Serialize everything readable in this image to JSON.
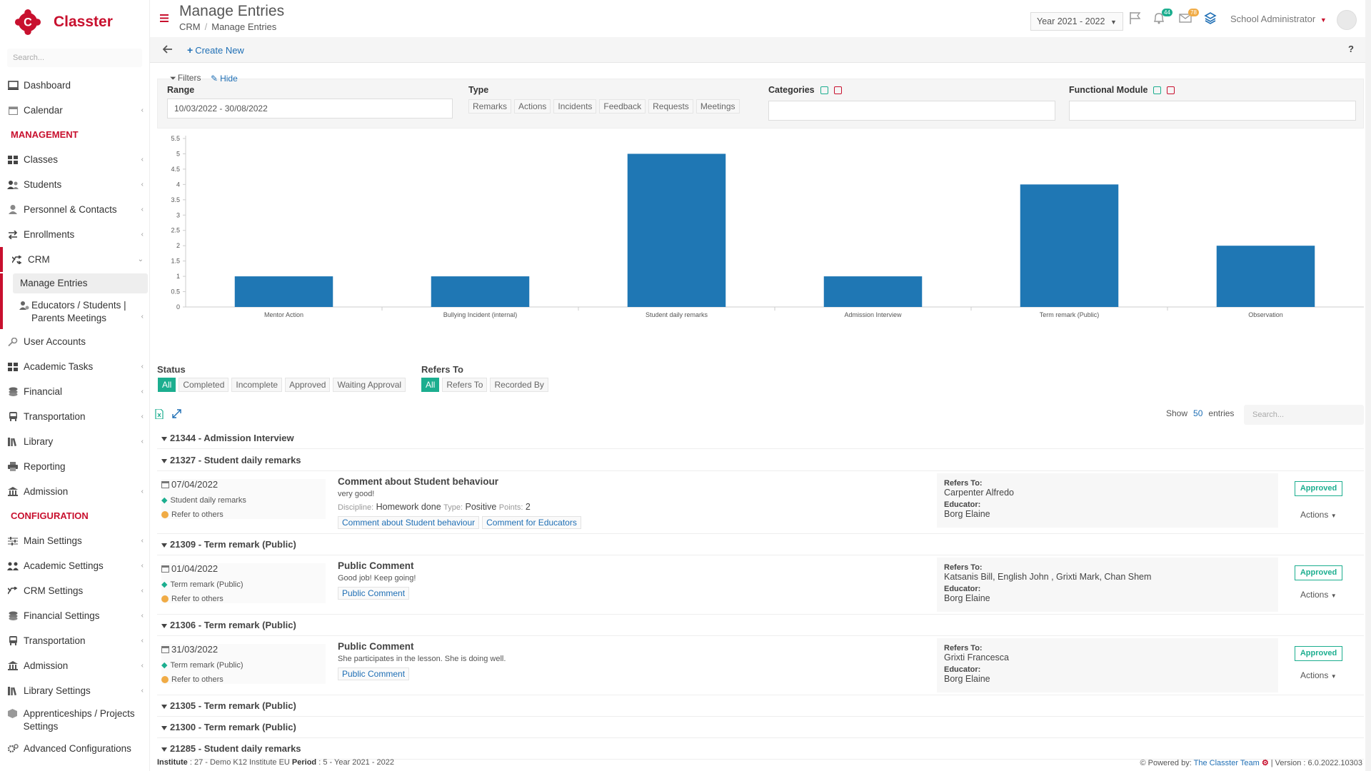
{
  "app": {
    "name": "Classter"
  },
  "sidebar": {
    "search_placeholder": "Search...",
    "items": [
      {
        "label": "Dashboard"
      },
      {
        "label": "Calendar"
      },
      {
        "section": "MANAGEMENT"
      },
      {
        "label": "Classes"
      },
      {
        "label": "Students"
      },
      {
        "label": "Personnel & Contacts"
      },
      {
        "label": "Enrollments"
      },
      {
        "label": "CRM"
      },
      {
        "label": "Manage Entries"
      },
      {
        "label": "Educators / Students | Parents Meetings"
      },
      {
        "label": "User Accounts"
      },
      {
        "label": "Academic Tasks"
      },
      {
        "label": "Financial"
      },
      {
        "label": "Transportation"
      },
      {
        "label": "Library"
      },
      {
        "label": "Reporting"
      },
      {
        "label": "Admission"
      },
      {
        "section": "CONFIGURATION"
      },
      {
        "label": "Main Settings"
      },
      {
        "label": "Academic Settings"
      },
      {
        "label": "CRM Settings"
      },
      {
        "label": "Financial Settings"
      },
      {
        "label": "Transportation"
      },
      {
        "label": "Admission"
      },
      {
        "label": "Library Settings"
      },
      {
        "label": "Apprenticeships / Projects Settings"
      },
      {
        "label": "Advanced Configurations"
      }
    ]
  },
  "header": {
    "title": "Manage Entries",
    "breadcrumb": [
      "CRM",
      "Manage Entries"
    ],
    "year": "Year 2021 - 2022",
    "notifications_count": "44",
    "messages_count": "78",
    "user": "School Administrator"
  },
  "toolbar": {
    "create_label": "Create New",
    "help": "?"
  },
  "filters": {
    "label": "Filters",
    "hide": "Hide",
    "range_label": "Range",
    "range_value": "10/03/2022 - 30/08/2022",
    "type_label": "Type",
    "types": [
      "Remarks",
      "Actions",
      "Incidents",
      "Feedback",
      "Requests",
      "Meetings"
    ],
    "categories_label": "Categories",
    "functional_label": "Functional Module"
  },
  "chart_data": {
    "type": "bar",
    "categories": [
      "Mentor Action",
      "Bullying Incident (internal)",
      "Student daily remarks",
      "Admission Interview",
      "Term remark (Public)",
      "Observation"
    ],
    "values": [
      1,
      1,
      5,
      1,
      4,
      2
    ],
    "ylim": [
      0,
      5.5
    ],
    "yticks": [
      "0",
      "0.5",
      "1",
      "1.5",
      "2",
      "2.5",
      "3",
      "3.5",
      "4",
      "4.5",
      "5",
      "5.5"
    ],
    "color": "#1f77b4"
  },
  "status": {
    "label": "Status",
    "options": [
      "All",
      "Completed",
      "Incomplete",
      "Approved",
      "Waiting Approval"
    ],
    "refers_label": "Refers To",
    "refers_options": [
      "All",
      "Refers To",
      "Recorded By"
    ]
  },
  "list": {
    "show": "Show",
    "count": "50",
    "entries": "entries",
    "search_placeholder": "Search..."
  },
  "groups": [
    {
      "head": "21344 - Admission Interview"
    },
    {
      "head": "21327 - Student daily remarks"
    },
    {
      "head": "21309 - Term remark (Public)"
    },
    {
      "head": "21306 - Term remark (Public)"
    },
    {
      "head": "21305 - Term remark (Public)"
    },
    {
      "head": "21300 - Term remark (Public)"
    },
    {
      "head": "21285 - Student daily remarks"
    }
  ],
  "entries": [
    {
      "date": "07/04/2022",
      "category": "Student daily remarks",
      "refer": "Refer to others",
      "title": "Comment about Student behaviour",
      "body": "very good!",
      "discipline_key": "Discipline:",
      "discipline": "Homework done",
      "type_key": "Type:",
      "type": "Positive",
      "points_key": "Points:",
      "points": "2",
      "tags": [
        "Comment about Student behaviour",
        "Comment for Educators"
      ],
      "refers_to_label": "Refers To:",
      "refers_to": "Carpenter Alfredo",
      "educator_label": "Educator:",
      "educator": "Borg Elaine",
      "status": "Approved",
      "actions": "Actions"
    },
    {
      "date": "01/04/2022",
      "category": "Term remark (Public)",
      "refer": "Refer to others",
      "title": "Public Comment",
      "body": "Good job! Keep going!",
      "tags": [
        "Public Comment"
      ],
      "refers_to_label": "Refers To:",
      "refers_to": "Katsanis Bill, English John , Grixti Mark, Chan Shem",
      "educator_label": "Educator:",
      "educator": "Borg Elaine",
      "status": "Approved",
      "actions": "Actions"
    },
    {
      "date": "31/03/2022",
      "category": "Term remark (Public)",
      "refer": "Refer to others",
      "title": "Public Comment",
      "body": "She participates in the lesson. She is doing well.",
      "tags": [
        "Public Comment"
      ],
      "refers_to_label": "Refers To:",
      "refers_to": "Grixti Francesca",
      "educator_label": "Educator:",
      "educator": "Borg Elaine",
      "status": "Approved",
      "actions": "Actions"
    }
  ],
  "footer": {
    "institute_key": "Institute",
    "institute": ": 27 - Demo K12 Institute EU",
    "period_key": "Period",
    "period": ": 5 - Year 2021 - 2022",
    "powered": "Powered by:",
    "team": "The Classter Team",
    "version": "| Version : 6.0.2022.10303"
  }
}
